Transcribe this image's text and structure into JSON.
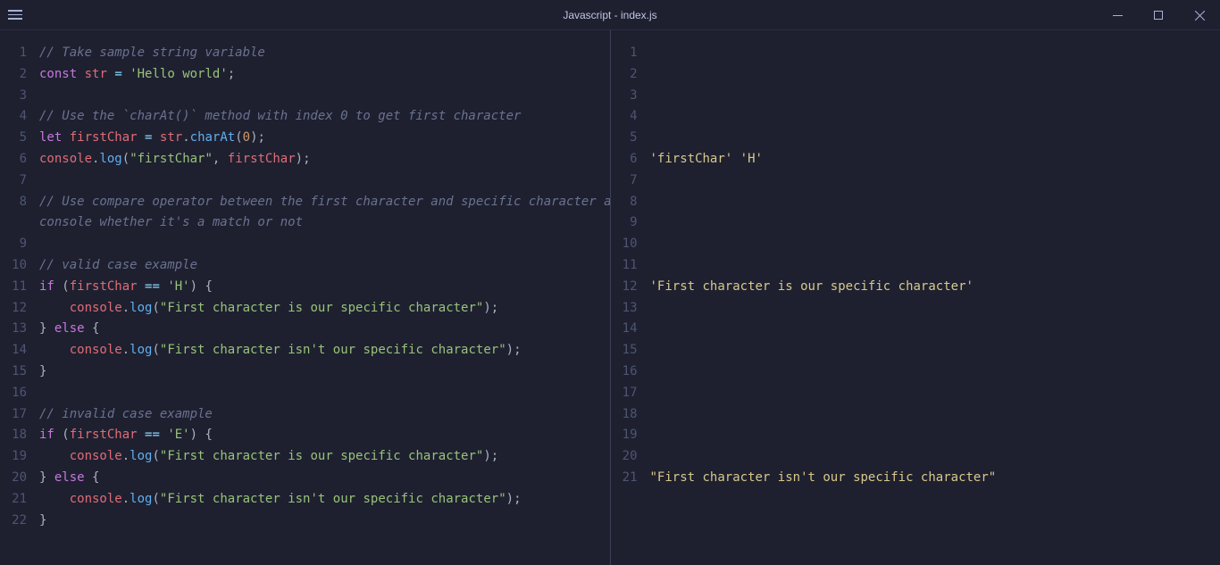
{
  "title": "Javascript - index.js",
  "leftLines": 22,
  "rightLines": 21,
  "code": [
    [
      [
        "c-comment",
        "// Take sample string variable"
      ]
    ],
    [
      [
        "c-const",
        "const"
      ],
      [
        "",
        ""
      ],
      [
        "",
        " "
      ],
      [
        "c-var",
        "str"
      ],
      [
        "",
        " "
      ],
      [
        "c-op",
        "="
      ],
      [
        "",
        " "
      ],
      [
        "c-string",
        "'Hello world'"
      ],
      [
        "c-punc",
        ";"
      ]
    ],
    [],
    [
      [
        "c-comment",
        "// Use the `charAt()` method with index 0 to get first character"
      ]
    ],
    [
      [
        "c-keyword",
        "let"
      ],
      [
        "",
        " "
      ],
      [
        "c-var",
        "firstChar"
      ],
      [
        "",
        " "
      ],
      [
        "c-op",
        "="
      ],
      [
        "",
        " "
      ],
      [
        "c-var",
        "str"
      ],
      [
        "c-punc",
        "."
      ],
      [
        "c-func",
        "charAt"
      ],
      [
        "c-punc",
        "("
      ],
      [
        "c-num",
        "0"
      ],
      [
        "c-punc",
        ")"
      ],
      [
        "c-punc",
        ";"
      ]
    ],
    [
      [
        "c-var",
        "console"
      ],
      [
        "c-punc",
        "."
      ],
      [
        "c-func",
        "log"
      ],
      [
        "c-punc",
        "("
      ],
      [
        "c-string",
        "\"firstChar\""
      ],
      [
        "c-punc",
        ","
      ],
      [
        "",
        " "
      ],
      [
        "c-var",
        "firstChar"
      ],
      [
        "c-punc",
        ")"
      ],
      [
        "c-punc",
        ";"
      ]
    ],
    [],
    [
      [
        "c-comment",
        "// Use compare operator between the first character and specific character and console whether it's a match or not"
      ]
    ],
    [],
    [
      [
        "c-comment",
        "// valid case example"
      ]
    ],
    [
      [
        "c-keyword",
        "if"
      ],
      [
        "",
        " "
      ],
      [
        "c-punc",
        "("
      ],
      [
        "c-var",
        "firstChar"
      ],
      [
        "",
        " "
      ],
      [
        "c-op",
        "=="
      ],
      [
        "",
        " "
      ],
      [
        "c-string",
        "'H'"
      ],
      [
        "c-punc",
        ")"
      ],
      [
        "",
        " "
      ],
      [
        "c-punc",
        "{"
      ]
    ],
    [
      [
        "",
        "    "
      ],
      [
        "c-var",
        "console"
      ],
      [
        "c-punc",
        "."
      ],
      [
        "c-func",
        "log"
      ],
      [
        "c-punc",
        "("
      ],
      [
        "c-string",
        "\"First character is our specific character\""
      ],
      [
        "c-punc",
        ")"
      ],
      [
        "c-punc",
        ";"
      ]
    ],
    [
      [
        "c-punc",
        "}"
      ],
      [
        "",
        " "
      ],
      [
        "c-keyword",
        "else"
      ],
      [
        "",
        " "
      ],
      [
        "c-punc",
        "{"
      ]
    ],
    [
      [
        "",
        "    "
      ],
      [
        "c-var",
        "console"
      ],
      [
        "c-punc",
        "."
      ],
      [
        "c-func",
        "log"
      ],
      [
        "c-punc",
        "("
      ],
      [
        "c-string",
        "\"First character isn't our specific character\""
      ],
      [
        "c-punc",
        ")"
      ],
      [
        "c-punc",
        ";"
      ]
    ],
    [
      [
        "c-punc",
        "}"
      ]
    ],
    [],
    [
      [
        "c-comment",
        "// invalid case example"
      ]
    ],
    [
      [
        "c-keyword",
        "if"
      ],
      [
        "",
        " "
      ],
      [
        "c-punc",
        "("
      ],
      [
        "c-var",
        "firstChar"
      ],
      [
        "",
        " "
      ],
      [
        "c-op",
        "=="
      ],
      [
        "",
        " "
      ],
      [
        "c-string",
        "'E'"
      ],
      [
        "c-punc",
        ")"
      ],
      [
        "",
        " "
      ],
      [
        "c-punc",
        "{"
      ]
    ],
    [
      [
        "",
        "    "
      ],
      [
        "c-var",
        "console"
      ],
      [
        "c-punc",
        "."
      ],
      [
        "c-func",
        "log"
      ],
      [
        "c-punc",
        "("
      ],
      [
        "c-string",
        "\"First character is our specific character\""
      ],
      [
        "c-punc",
        ")"
      ],
      [
        "c-punc",
        ";"
      ]
    ],
    [
      [
        "c-punc",
        "}"
      ],
      [
        "",
        " "
      ],
      [
        "c-keyword",
        "else"
      ],
      [
        "",
        " "
      ],
      [
        "c-punc",
        "{"
      ]
    ],
    [
      [
        "",
        "    "
      ],
      [
        "c-var",
        "console"
      ],
      [
        "c-punc",
        "."
      ],
      [
        "c-func",
        "log"
      ],
      [
        "c-punc",
        "("
      ],
      [
        "c-string",
        "\"First character isn't our specific character\""
      ],
      [
        "c-punc",
        ")"
      ],
      [
        "c-punc",
        ";"
      ]
    ],
    [
      [
        "c-punc",
        "}"
      ]
    ]
  ],
  "wrapLine": 8,
  "output": {
    "6": "'firstChar' 'H'",
    "12": "'First character is our specific character'",
    "21": "\"First character isn't our specific character\""
  }
}
